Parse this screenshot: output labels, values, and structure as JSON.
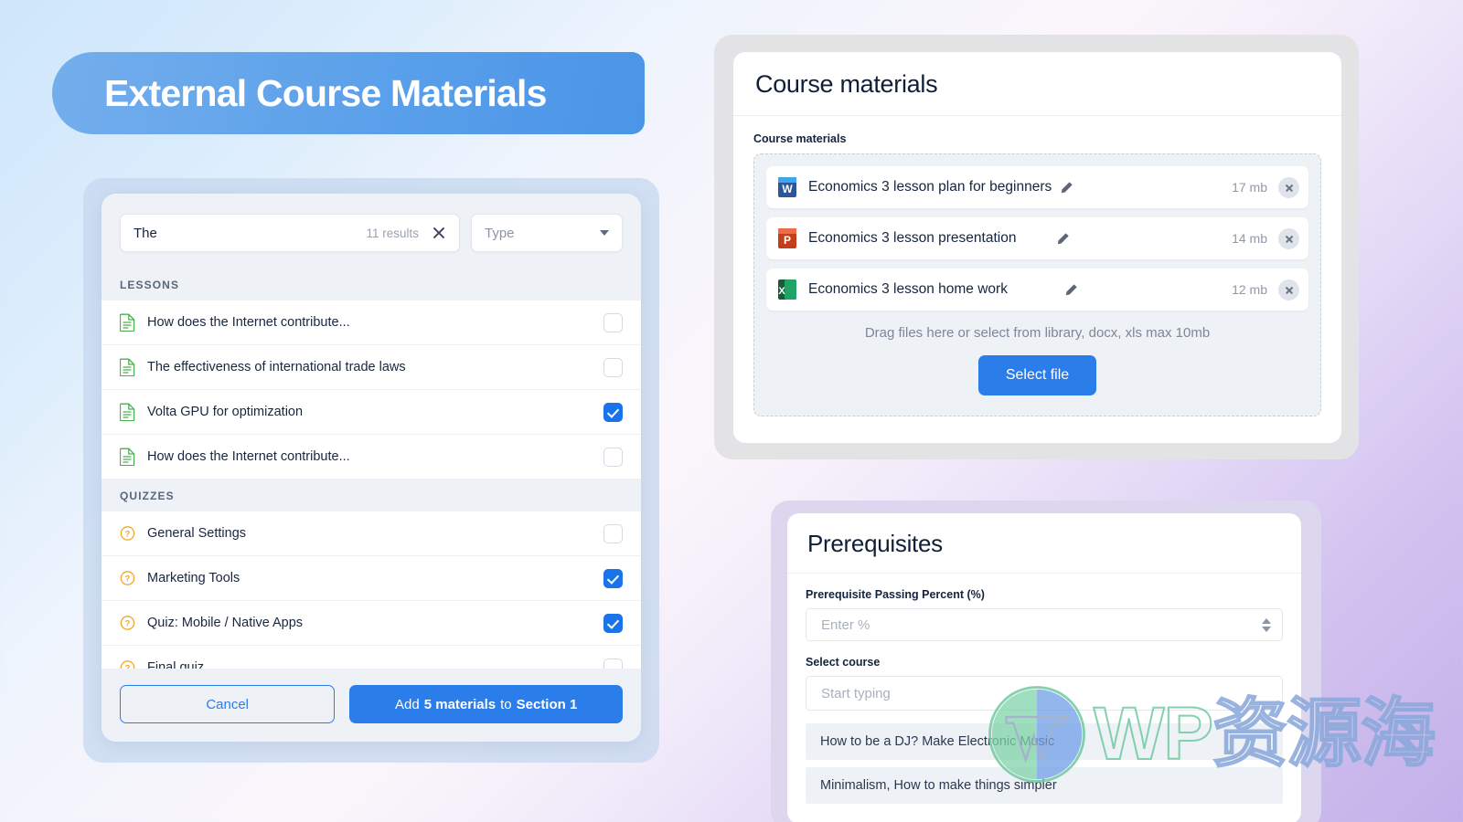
{
  "page": {
    "banner_title": "External Course Materials",
    "accent_blue": "#2b7de9",
    "banner_blue": "#5aa0ea"
  },
  "picker": {
    "search": {
      "value": "The",
      "results_text": "11 results",
      "clear_icon": "close-icon"
    },
    "type_filter": {
      "label": "Type",
      "caret_icon": "chevron-down-icon"
    },
    "groups": [
      {
        "header": "LESSONS",
        "items": [
          {
            "label": "How does the Internet contribute...",
            "checked": false,
            "icon": "document-icon"
          },
          {
            "label": "The effectiveness of international trade laws",
            "checked": false,
            "icon": "document-icon"
          },
          {
            "label": "Volta GPU for optimization",
            "checked": true,
            "icon": "document-icon"
          },
          {
            "label": "How does the Internet contribute...",
            "checked": false,
            "icon": "document-icon"
          }
        ]
      },
      {
        "header": "QUIZZES",
        "items": [
          {
            "label": "General Settings",
            "checked": false,
            "icon": "quiz-icon"
          },
          {
            "label": "Marketing Tools",
            "checked": true,
            "icon": "quiz-icon"
          },
          {
            "label": "Quiz: Mobile / Native Apps",
            "checked": true,
            "icon": "quiz-icon"
          },
          {
            "label": "Final quiz",
            "checked": false,
            "icon": "quiz-icon"
          }
        ]
      }
    ],
    "footer": {
      "cancel_label": "Cancel",
      "add_prefix": "Add",
      "add_count": "5 materials",
      "add_middle": "to",
      "add_section": "Section 1"
    }
  },
  "course_materials": {
    "card_title": "Course materials",
    "field_label": "Course materials",
    "files": [
      {
        "name": "Economics 3 lesson plan for beginners",
        "size": "17 mb",
        "type": "word",
        "edit_icon": "pencil-icon",
        "remove_icon": "close-circle-icon"
      },
      {
        "name": "Economics 3 lesson presentation",
        "size": "14 mb",
        "type": "powerpoint",
        "edit_icon": "pencil-icon",
        "remove_icon": "close-circle-icon"
      },
      {
        "name": "Economics 3 lesson home work",
        "size": "12 mb",
        "type": "excel",
        "edit_icon": "pencil-icon",
        "remove_icon": "close-circle-icon"
      }
    ],
    "drop_hint": "Drag files here or select from library, docx, xls max 10mb",
    "select_file_label": "Select file"
  },
  "prerequisites": {
    "card_title": "Prerequisites",
    "passing_percent_label": "Prerequisite Passing Percent (%)",
    "passing_percent_placeholder": "Enter %",
    "select_course_label": "Select course",
    "select_course_placeholder": "Start typing",
    "suggestions": [
      "How to be a DJ? Make Electronic Music",
      "Minimalism, How to make things simpler"
    ]
  },
  "watermark": {
    "latin": "WP",
    "chinese": "资源海"
  }
}
